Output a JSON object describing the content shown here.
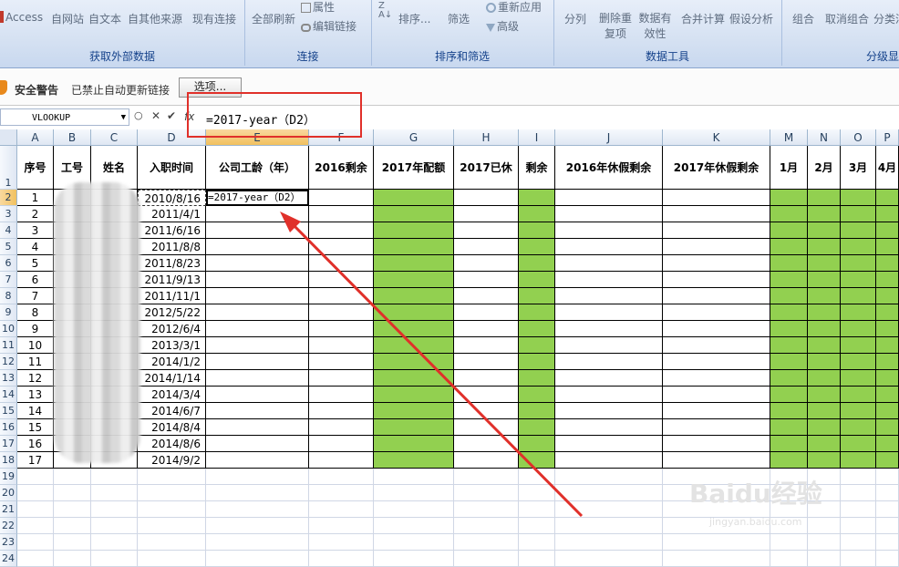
{
  "ribbon": {
    "groups": [
      {
        "title": "获取外部数据",
        "buttons": [
          "Access",
          "自网站",
          "自文本",
          "自其他来源",
          "现有连接"
        ]
      },
      {
        "title": "连接",
        "buttons": [
          "全部刷新",
          "属性",
          "编辑链接"
        ]
      },
      {
        "title": "排序和筛选",
        "buttons": [
          "排序...",
          "筛选",
          "重新应用",
          "高级"
        ]
      },
      {
        "title": "数据工具",
        "buttons": [
          "分列",
          "删除重复项",
          "数据有效性",
          "合并计算",
          "假设分析"
        ]
      },
      {
        "title": "分级显",
        "buttons": [
          "组合",
          "取消组合",
          "分类汇"
        ]
      }
    ]
  },
  "security_bar": {
    "title": "安全警告",
    "message": "已禁止自动更新链接",
    "options_label": "选项..."
  },
  "formula_bar": {
    "name_box": "VLOOKUP",
    "fx": "fx",
    "formula": "=2017-year（D2）"
  },
  "grid": {
    "columns": [
      "A",
      "B",
      "C",
      "D",
      "E",
      "F",
      "G",
      "H",
      "I",
      "J",
      "K",
      "M",
      "N",
      "O",
      "P"
    ],
    "selected_column": "E",
    "rows": [
      "1",
      "2",
      "3",
      "4",
      "5",
      "6",
      "7",
      "8",
      "9",
      "10",
      "11",
      "12",
      "13",
      "14",
      "15",
      "16",
      "17",
      "18",
      "19",
      "20",
      "21",
      "22",
      "23",
      "24"
    ],
    "selected_row": "2",
    "headers": [
      "序号",
      "工号",
      "姓名",
      "入职时间",
      "公司工龄（年）",
      "2016剩余",
      "2017年配额",
      "2017已休",
      "剩余",
      "2016年休假剩余",
      "2017年休假剩余",
      "1月",
      "2月",
      "3月",
      "4月"
    ],
    "seq": [
      "1",
      "2",
      "3",
      "4",
      "5",
      "6",
      "7",
      "8",
      "9",
      "10",
      "11",
      "12",
      "13",
      "14",
      "15",
      "16",
      "17"
    ],
    "dates": [
      "2010/8/16",
      "2011/4/1",
      "2011/6/16",
      "2011/8/8",
      "2011/8/23",
      "2011/9/13",
      "2011/11/1",
      "2012/5/22",
      "2012/6/4",
      "2013/3/1",
      "2014/1/2",
      "2014/1/14",
      "2014/3/4",
      "2014/6/7",
      "2014/8/4",
      "2014/8/6",
      "2014/9/2"
    ],
    "active_cell_value": "=2017-year（D2）",
    "green_color": "#92d050"
  },
  "watermark": {
    "logo": "Baidu经验",
    "url": "jingyan.baidu.com"
  }
}
